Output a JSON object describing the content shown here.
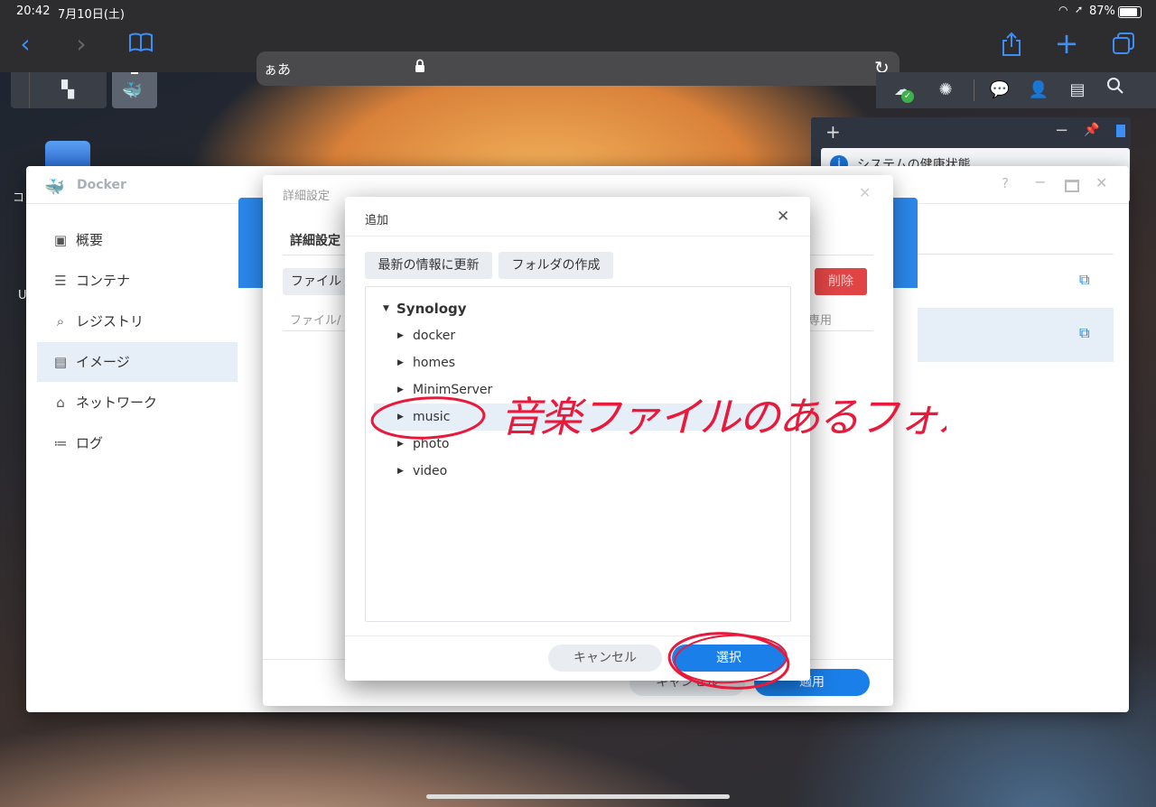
{
  "status_bar": {
    "time": "20:42",
    "date": "7月10日(土)",
    "battery": "87%"
  },
  "browser": {
    "url_label": "ぁあ"
  },
  "docker_window": {
    "title": "Docker",
    "sidebar": [
      {
        "label": "概要",
        "icon": "overview-icon"
      },
      {
        "label": "コンテナ",
        "icon": "container-icon"
      },
      {
        "label": "レジストリ",
        "icon": "registry-icon"
      },
      {
        "label": "イメージ",
        "icon": "image-icon"
      },
      {
        "label": "ネットワーク",
        "icon": "network-icon"
      },
      {
        "label": "ログ",
        "icon": "log-icon"
      }
    ],
    "active_item": "イメージ"
  },
  "widget": {
    "title": "システムの健康状態"
  },
  "detail_dialog": {
    "title": "詳細設定",
    "tab": "詳細設定",
    "file_button": "ファイル",
    "delete_button": "削除",
    "column_file": "ファイル/",
    "column_readonly": "専用",
    "cancel": "キャンセル",
    "apply": "適用"
  },
  "add_dialog": {
    "title": "追加",
    "refresh_button": "最新の情報に更新",
    "create_folder_button": "フォルダの作成",
    "tree_root": "Synology",
    "tree_items": [
      "docker",
      "homes",
      "MinimServer",
      "music",
      "photo",
      "video"
    ],
    "selected_item": "music",
    "cancel": "キャンセル",
    "select": "選択"
  },
  "annotation": {
    "text": "音楽ファイルのあるフォルダ",
    "color": "#e8193a"
  },
  "colors": {
    "accent": "#1a7fe8",
    "danger": "#e04444",
    "toolbar_icon": "#3d8ff5"
  }
}
